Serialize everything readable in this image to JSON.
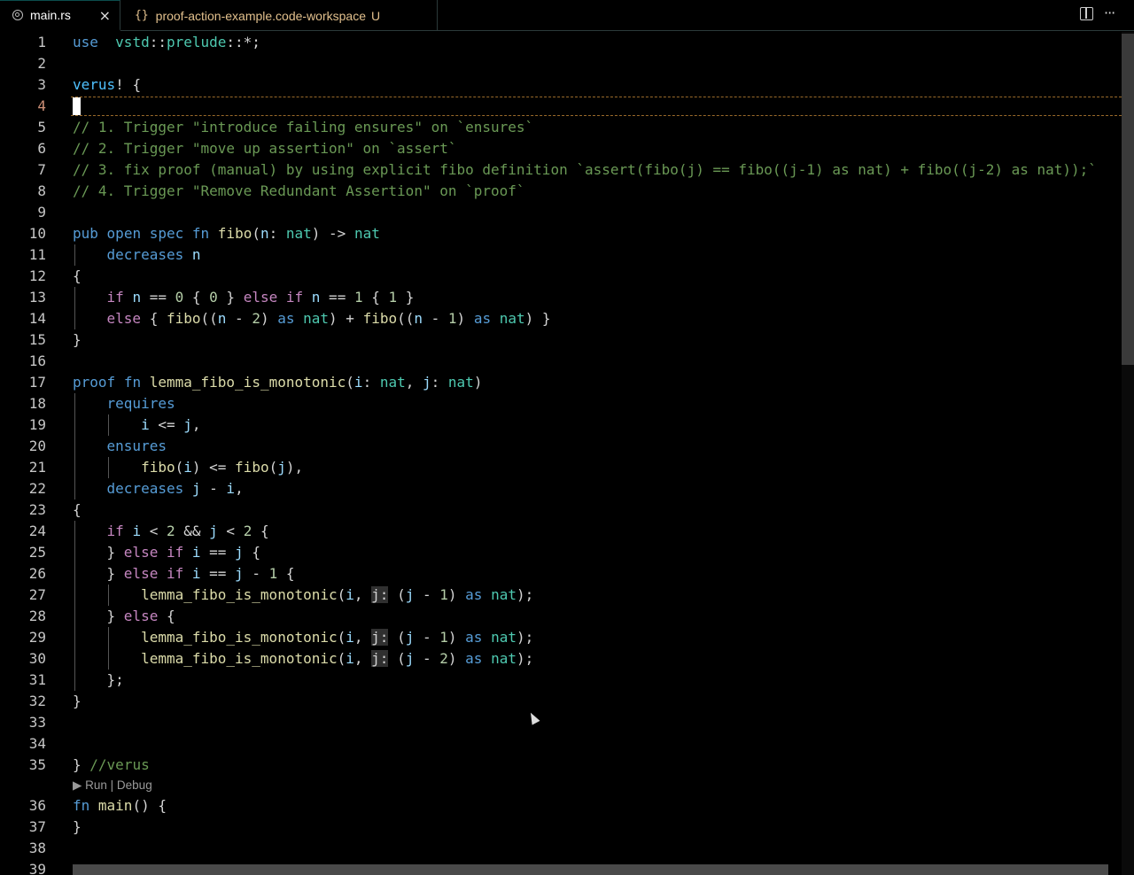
{
  "tabs": [
    {
      "label": "main.rs",
      "icon": "rust-icon",
      "close": "×",
      "active": true
    },
    {
      "label": "proof-action-example.code-workspace",
      "icon": "json-braces-icon",
      "icon_text": "{}",
      "status": "U",
      "active": false
    }
  ],
  "toolbar": {
    "split_icon": "split-editor-icon",
    "more": "···"
  },
  "gutter": [
    "1",
    "2",
    "3",
    "4",
    "5",
    "6",
    "7",
    "8",
    "9",
    "10",
    "11",
    "12",
    "13",
    "14",
    "15",
    "16",
    "17",
    "18",
    "19",
    "20",
    "21",
    "22",
    "23",
    "24",
    "25",
    "26",
    "27",
    "28",
    "29",
    "30",
    "31",
    "32",
    "33",
    "34",
    "35",
    "36",
    "37",
    "38",
    "39"
  ],
  "codelens": {
    "run": "▶ Run",
    "sep": " | ",
    "debug": "Debug"
  },
  "code": {
    "l1": [
      [
        "kw",
        "use"
      ],
      [
        "",
        "  "
      ],
      [
        "ty",
        "vstd"
      ],
      [
        "",
        "::"
      ],
      [
        "ty",
        "prelude"
      ],
      [
        "",
        "::*;"
      ]
    ],
    "l3": [
      [
        "macro",
        "verus"
      ],
      [
        "",
        "! "
      ],
      [
        "",
        "{"
      ]
    ],
    "l5": [
      [
        "cm",
        "// 1. Trigger \"introduce failing ensures\" on `ensures`"
      ]
    ],
    "l6": [
      [
        "cm",
        "// 2. Trigger \"move up assertion\" on `assert`"
      ]
    ],
    "l7": [
      [
        "cm",
        "// 3. fix proof (manual) by using explicit fibo definition `assert(fibo(j) == fibo((j-1) as nat) + fibo((j-2) as nat));`"
      ]
    ],
    "l8": [
      [
        "cm",
        "// 4. Trigger \"Remove Redundant Assertion\" on `proof`"
      ]
    ],
    "l10": [
      [
        "kw",
        "pub"
      ],
      [
        "",
        " "
      ],
      [
        "kw",
        "open"
      ],
      [
        "",
        " "
      ],
      [
        "kw",
        "spec"
      ],
      [
        "",
        " "
      ],
      [
        "kw",
        "fn"
      ],
      [
        "",
        " "
      ],
      [
        "fn",
        "fibo"
      ],
      [
        "",
        "("
      ],
      [
        "var",
        "n"
      ],
      [
        "",
        ": "
      ],
      [
        "ty",
        "nat"
      ],
      [
        "",
        ") -> "
      ],
      [
        "ty",
        "nat"
      ]
    ],
    "l11": [
      [
        "",
        "    "
      ],
      [
        "kw",
        "decreases"
      ],
      [
        "",
        " "
      ],
      [
        "var",
        "n"
      ]
    ],
    "l12": [
      [
        "",
        "{"
      ]
    ],
    "l13": [
      [
        "",
        "    "
      ],
      [
        "ctl",
        "if"
      ],
      [
        "",
        " "
      ],
      [
        "var",
        "n"
      ],
      [
        "",
        " == "
      ],
      [
        "num",
        "0"
      ],
      [
        "",
        " { "
      ],
      [
        "num",
        "0"
      ],
      [
        "",
        " } "
      ],
      [
        "ctl",
        "else"
      ],
      [
        "",
        " "
      ],
      [
        "ctl",
        "if"
      ],
      [
        "",
        " "
      ],
      [
        "var",
        "n"
      ],
      [
        "",
        " == "
      ],
      [
        "num",
        "1"
      ],
      [
        "",
        " { "
      ],
      [
        "num",
        "1"
      ],
      [
        "",
        " }"
      ]
    ],
    "l14": [
      [
        "",
        "    "
      ],
      [
        "ctl",
        "else"
      ],
      [
        "",
        " { "
      ],
      [
        "fn",
        "fibo"
      ],
      [
        "",
        "(("
      ],
      [
        "var",
        "n"
      ],
      [
        "",
        " - "
      ],
      [
        "num",
        "2"
      ],
      [
        "",
        ") "
      ],
      [
        "kw",
        "as"
      ],
      [
        "",
        " "
      ],
      [
        "ty",
        "nat"
      ],
      [
        "",
        ") + "
      ],
      [
        "fn",
        "fibo"
      ],
      [
        "",
        "(("
      ],
      [
        "var",
        "n"
      ],
      [
        "",
        " - "
      ],
      [
        "num",
        "1"
      ],
      [
        "",
        ") "
      ],
      [
        "kw",
        "as"
      ],
      [
        "",
        " "
      ],
      [
        "ty",
        "nat"
      ],
      [
        "",
        ") }"
      ]
    ],
    "l15": [
      [
        "",
        "}"
      ]
    ],
    "l17": [
      [
        "kw",
        "proof"
      ],
      [
        "",
        " "
      ],
      [
        "kw",
        "fn"
      ],
      [
        "",
        " "
      ],
      [
        "fn",
        "lemma_fibo_is_monotonic"
      ],
      [
        "",
        "("
      ],
      [
        "var",
        "i"
      ],
      [
        "",
        ": "
      ],
      [
        "ty",
        "nat"
      ],
      [
        "",
        ", "
      ],
      [
        "var",
        "j"
      ],
      [
        "",
        ": "
      ],
      [
        "ty",
        "nat"
      ],
      [
        "",
        ")"
      ]
    ],
    "l18": [
      [
        "",
        "    "
      ],
      [
        "kw",
        "requires"
      ]
    ],
    "l19": [
      [
        "",
        "        "
      ],
      [
        "var",
        "i"
      ],
      [
        "",
        " <= "
      ],
      [
        "var",
        "j"
      ],
      [
        "",
        ","
      ]
    ],
    "l20": [
      [
        "",
        "    "
      ],
      [
        "kw",
        "ensures"
      ]
    ],
    "l21": [
      [
        "",
        "        "
      ],
      [
        "fn",
        "fibo"
      ],
      [
        "",
        "("
      ],
      [
        "var",
        "i"
      ],
      [
        "",
        ") <= "
      ],
      [
        "fn",
        "fibo"
      ],
      [
        "",
        "("
      ],
      [
        "var",
        "j"
      ],
      [
        "",
        "),"
      ]
    ],
    "l22": [
      [
        "",
        "    "
      ],
      [
        "kw",
        "decreases"
      ],
      [
        "",
        " "
      ],
      [
        "var",
        "j"
      ],
      [
        "",
        " - "
      ],
      [
        "var",
        "i"
      ],
      [
        "",
        ","
      ]
    ],
    "l23": [
      [
        "",
        "{"
      ]
    ],
    "l24": [
      [
        "",
        "    "
      ],
      [
        "ctl",
        "if"
      ],
      [
        "",
        " "
      ],
      [
        "var",
        "i"
      ],
      [
        "",
        " < "
      ],
      [
        "num",
        "2"
      ],
      [
        "",
        " && "
      ],
      [
        "var",
        "j"
      ],
      [
        "",
        " < "
      ],
      [
        "num",
        "2"
      ],
      [
        "",
        " {"
      ]
    ],
    "l25": [
      [
        "",
        "    } "
      ],
      [
        "ctl",
        "else"
      ],
      [
        "",
        " "
      ],
      [
        "ctl",
        "if"
      ],
      [
        "",
        " "
      ],
      [
        "var",
        "i"
      ],
      [
        "",
        " == "
      ],
      [
        "var",
        "j"
      ],
      [
        "",
        " {"
      ]
    ],
    "l26": [
      [
        "",
        "    } "
      ],
      [
        "ctl",
        "else"
      ],
      [
        "",
        " "
      ],
      [
        "ctl",
        "if"
      ],
      [
        "",
        " "
      ],
      [
        "var",
        "i"
      ],
      [
        "",
        " == "
      ],
      [
        "var",
        "j"
      ],
      [
        "",
        " - "
      ],
      [
        "num",
        "1"
      ],
      [
        "",
        " {"
      ]
    ],
    "l27": [
      [
        "",
        "        "
      ],
      [
        "fn",
        "lemma_fibo_is_monotonic"
      ],
      [
        "",
        "("
      ],
      [
        "var",
        "i"
      ],
      [
        "",
        ", "
      ],
      [
        "hint",
        "j:"
      ],
      [
        "",
        " ("
      ],
      [
        "var",
        "j"
      ],
      [
        "",
        " - "
      ],
      [
        "num",
        "1"
      ],
      [
        "",
        ") "
      ],
      [
        "kw",
        "as"
      ],
      [
        "",
        " "
      ],
      [
        "ty",
        "nat"
      ],
      [
        "",
        ");"
      ]
    ],
    "l28": [
      [
        "",
        "    } "
      ],
      [
        "ctl",
        "else"
      ],
      [
        "",
        " {"
      ]
    ],
    "l29": [
      [
        "",
        "        "
      ],
      [
        "fn",
        "lemma_fibo_is_monotonic"
      ],
      [
        "",
        "("
      ],
      [
        "var",
        "i"
      ],
      [
        "",
        ", "
      ],
      [
        "hint",
        "j:"
      ],
      [
        "",
        " ("
      ],
      [
        "var",
        "j"
      ],
      [
        "",
        " - "
      ],
      [
        "num",
        "1"
      ],
      [
        "",
        ") "
      ],
      [
        "kw",
        "as"
      ],
      [
        "",
        " "
      ],
      [
        "ty",
        "nat"
      ],
      [
        "",
        ");"
      ]
    ],
    "l30": [
      [
        "",
        "        "
      ],
      [
        "fn",
        "lemma_fibo_is_monotonic"
      ],
      [
        "",
        "("
      ],
      [
        "var",
        "i"
      ],
      [
        "",
        ", "
      ],
      [
        "hint",
        "j:"
      ],
      [
        "",
        " ("
      ],
      [
        "var",
        "j"
      ],
      [
        "",
        " - "
      ],
      [
        "num",
        "2"
      ],
      [
        "",
        ") "
      ],
      [
        "kw",
        "as"
      ],
      [
        "",
        " "
      ],
      [
        "ty",
        "nat"
      ],
      [
        "",
        ");"
      ]
    ],
    "l31": [
      [
        "",
        "    };"
      ]
    ],
    "l32": [
      [
        "",
        "}"
      ]
    ],
    "l35": [
      [
        "",
        "}"
      ],
      [
        "",
        " "
      ],
      [
        "cm",
        "//verus"
      ]
    ],
    "l36": [
      [
        "kw",
        "fn"
      ],
      [
        "",
        " "
      ],
      [
        "fn",
        "main"
      ],
      [
        "",
        "() {"
      ]
    ],
    "l37": [
      [
        "",
        "}"
      ]
    ]
  }
}
